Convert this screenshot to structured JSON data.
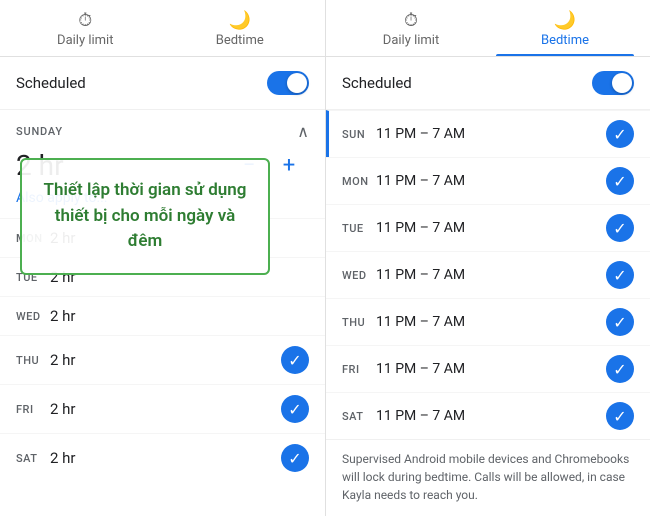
{
  "left_panel": {
    "tabs": [
      {
        "id": "daily",
        "icon": "⏱",
        "label": "Daily limit",
        "active": false
      },
      {
        "id": "bedtime",
        "icon": "🌙",
        "label": "Bedtime",
        "active": false
      }
    ],
    "scheduled_label": "Scheduled",
    "sunday_label": "SUNDAY",
    "hour_value": "2 hr",
    "also_apply": "Also apply to...",
    "days": [
      {
        "abbr": "MON",
        "value": "2 hr",
        "checked": false
      },
      {
        "abbr": "TUE",
        "value": "2 hr",
        "checked": false
      },
      {
        "abbr": "WED",
        "value": "2 hr",
        "checked": false
      },
      {
        "abbr": "THU",
        "value": "2 hr",
        "checked": true
      },
      {
        "abbr": "FRI",
        "value": "2 hr",
        "checked": true
      },
      {
        "abbr": "SAT",
        "value": "2 hr",
        "checked": true
      }
    ]
  },
  "right_panel": {
    "tabs": [
      {
        "id": "daily",
        "icon": "⏱",
        "label": "Daily limit",
        "active": false
      },
      {
        "id": "bedtime",
        "icon": "🌙",
        "label": "Bedtime",
        "active": true
      }
    ],
    "scheduled_label": "Scheduled",
    "days": [
      {
        "abbr": "SUN",
        "time": "11 PM – 7 AM",
        "accent": true
      },
      {
        "abbr": "MON",
        "time": "11 PM – 7 AM",
        "accent": false
      },
      {
        "abbr": "TUE",
        "time": "11 PM – 7 AM",
        "accent": false
      },
      {
        "abbr": "WED",
        "time": "11 PM – 7 AM",
        "accent": false
      },
      {
        "abbr": "THU",
        "time": "11 PM – 7 AM",
        "accent": false
      },
      {
        "abbr": "FRI",
        "time": "11 PM – 7 AM",
        "accent": false
      },
      {
        "abbr": "SAT",
        "time": "11 PM – 7 AM",
        "accent": false
      }
    ],
    "footer": "Supervised Android mobile devices and Chromebooks will lock during bedtime. Calls will be allowed, in case Kayla needs to reach you."
  },
  "overlay": {
    "text": "Thiết lập thời gian sử dụng thiết bị cho mỗi ngày và đêm"
  }
}
